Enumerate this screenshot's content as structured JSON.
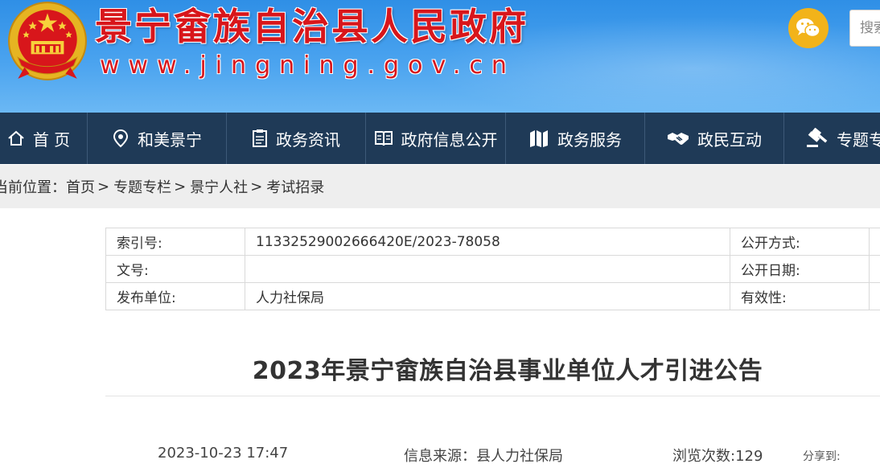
{
  "header": {
    "site_name": "景宁畲族自治县人民政府",
    "site_url": "www.jingning.gov.cn",
    "search_placeholder": "搜索",
    "brand_color": "#d8161b",
    "wechat_color": "#f2b31a"
  },
  "nav": {
    "background": "#1f3a57",
    "items": [
      {
        "label": "首 页",
        "icon": "home-icon"
      },
      {
        "label": "和美景宁",
        "icon": "location-pin-icon"
      },
      {
        "label": "政务资讯",
        "icon": "clipboard-icon"
      },
      {
        "label": "政府信息公开",
        "icon": "open-book-icon"
      },
      {
        "label": "政务服务",
        "icon": "map-icon"
      },
      {
        "label": "政民互动",
        "icon": "handshake-icon"
      },
      {
        "label": "专题专栏",
        "icon": "gavel-icon"
      }
    ]
  },
  "breadcrumb": {
    "lead": "当前位置：",
    "items": [
      "首页",
      "专题专栏",
      "景宁人社",
      "考试招录"
    ],
    "separator": ">"
  },
  "meta_table": {
    "rows": [
      {
        "label": "索引号:",
        "value": "11332529002666420E/2023-78058",
        "label2": "公开方式:",
        "value2": ""
      },
      {
        "label": "文号:",
        "value": "",
        "label2": "公开日期:",
        "value2": ""
      },
      {
        "label": "发布单位:",
        "value": "人力社保局",
        "label2": "有效性:",
        "value2": ""
      }
    ]
  },
  "article": {
    "title": "2023年景宁畲族自治县事业单位人才引进公告",
    "date": "2023-10-23 17:47",
    "source": "信息来源：县人力社保局",
    "views": "浏览次数:129",
    "share_label": "分享到:"
  }
}
